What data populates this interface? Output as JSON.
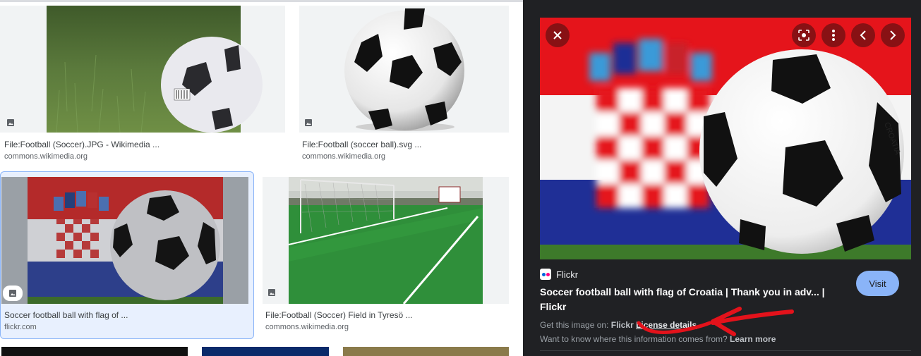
{
  "results": [
    {
      "title": "File:Football (Soccer).JPG - Wikimedia ...",
      "source": "commons.wikimedia.org"
    },
    {
      "title": "File:Football (soccer ball).svg ...",
      "source": "commons.wikimedia.org"
    },
    {
      "title": "Soccer football ball with flag of ...",
      "source": "flickr.com"
    },
    {
      "title": "File:Football (Soccer) Field in Tyresö ...",
      "source": "commons.wikimedia.org"
    }
  ],
  "panel": {
    "source_name": "Flickr",
    "title": "Soccer football ball with flag of Croatia | Thank you in adv... | Flickr",
    "visit_label": "Visit",
    "get_image_prefix": "Get this image on:",
    "get_image_source": "Flickr",
    "license_label": "License details",
    "info_question": "Want to know where this information comes from?",
    "learn_more": "Learn more"
  },
  "colors": {
    "panel_bg": "#202124",
    "visit_button": "#8ab4f8",
    "selected_border": "#8ab4f8",
    "annotation_red": "#e3121b",
    "flickr_blue": "#0063dc",
    "flickr_pink": "#ff0084"
  },
  "icons": {
    "image_badge": "image-icon",
    "close": "close-icon",
    "lens": "lens-icon",
    "more": "more-vert-icon",
    "prev": "chevron-left-icon",
    "next": "chevron-right-icon"
  }
}
